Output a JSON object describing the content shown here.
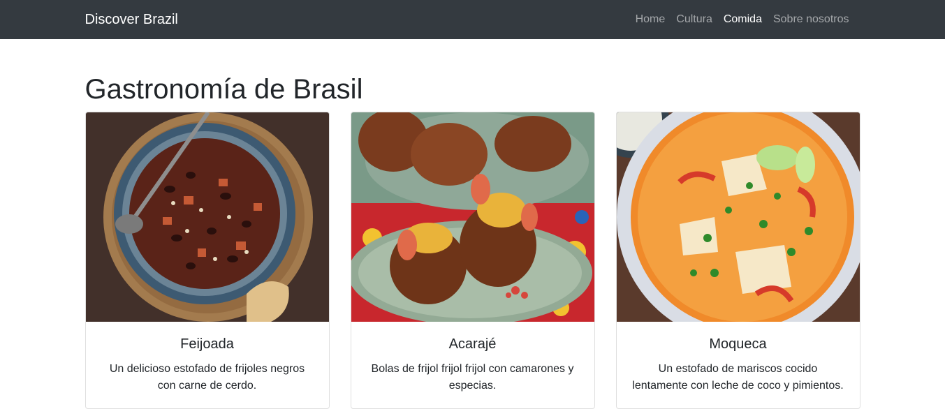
{
  "navbar": {
    "brand": "Discover Brazil",
    "links": [
      {
        "label": "Home"
      },
      {
        "label": "Cultura"
      },
      {
        "label": "Comida",
        "active": true
      },
      {
        "label": "Sobre nosotros"
      }
    ]
  },
  "main": {
    "title": "Gastronomía de Brasil",
    "cards": [
      {
        "title": "Feijoada",
        "text": "Un delicioso estofado de frijoles negros con carne de cerdo."
      },
      {
        "title": "Acarajé",
        "text": "Bolas de frijol frijol frijol con camarones y especias."
      },
      {
        "title": "Moqueca",
        "text": "Un estofado de mariscos cocido lentamente con leche de coco y pimientos."
      }
    ]
  }
}
